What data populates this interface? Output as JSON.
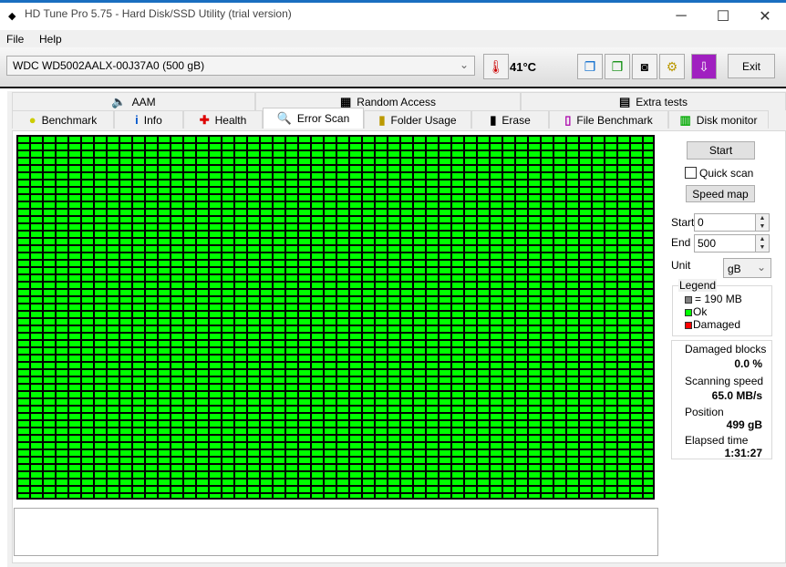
{
  "window": {
    "title": "HD Tune Pro 5.75 - Hard Disk/SSD Utility (trial version)",
    "minimize": "─",
    "maximize": "☐",
    "close": "✕"
  },
  "menu": [
    "File",
    "Help"
  ],
  "toolbar": {
    "drive": "WDC WD5002AALX-00J37A0 (500 gB)",
    "temperature": "41°C",
    "exit": "Exit",
    "icons": [
      "copy-info-icon",
      "copy-screen-icon",
      "camera-icon",
      "options-icon",
      "save-icon"
    ]
  },
  "tabs_top": [
    {
      "label": "AAM",
      "icon": "speaker-icon"
    },
    {
      "label": "Random Access",
      "icon": "scatter-icon"
    },
    {
      "label": "Extra tests",
      "icon": "chart-icon"
    }
  ],
  "tabs_bottom": [
    {
      "label": "Benchmark",
      "icon": "bulb-icon"
    },
    {
      "label": "Info",
      "icon": "info-icon"
    },
    {
      "label": "Health",
      "icon": "cross-icon"
    },
    {
      "label": "Error Scan",
      "icon": "magnifier-icon",
      "active": true
    },
    {
      "label": "Folder Usage",
      "icon": "folder-icon"
    },
    {
      "label": "Erase",
      "icon": "trash-icon"
    },
    {
      "label": "File Benchmark",
      "icon": "file-icon"
    },
    {
      "label": "Disk monitor",
      "icon": "monitor-icon"
    }
  ],
  "scan": {
    "start_button": "Start",
    "quick_scan": "Quick scan",
    "quick_scan_checked": false,
    "speed_map": "Speed map",
    "start_label": "Start",
    "start_value": "0",
    "end_label": "End",
    "end_value": "500",
    "unit_label": "Unit",
    "unit_value": "gB",
    "legend": {
      "title": "Legend",
      "block": "= 190 MB",
      "ok": "Ok",
      "damaged": "Damaged",
      "colors": {
        "block": "#808080",
        "ok": "#00ff00",
        "damaged": "#ff0000"
      }
    },
    "stats": {
      "damaged_label": "Damaged blocks",
      "damaged_value": "0.0 %",
      "speed_label": "Scanning speed",
      "speed_value": "65.0 MB/s",
      "position_label": "Position",
      "position_value": "499 gB",
      "elapsed_label": "Elapsed time",
      "elapsed_value": "1:31:27"
    },
    "grid_state": "all ok",
    "ok_color": "#00ff00"
  }
}
